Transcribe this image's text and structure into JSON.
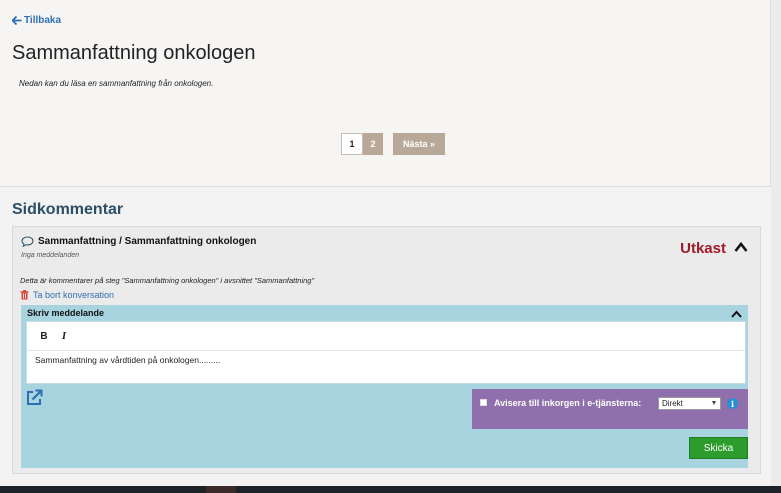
{
  "header": {
    "back_label": "Tillbaka",
    "title": "Sammanfattning onkologen",
    "intro": "Nedan kan du läsa en sammanfattning från onkologen."
  },
  "pager": {
    "current": "1",
    "page2": "2",
    "next_label": "Nästa »"
  },
  "comments": {
    "section_title": "Sidkommentar",
    "conversation": {
      "title": "Sammanfattning / Sammanfattning onkologen",
      "subtitle": "Inga meddelanden",
      "status": "Utkast",
      "description": "Detta är kommentarer på steg \"Sammanfattning onkologen\" i avsnittet \"Sammanfattning\"",
      "delete_label": "Ta bort konversation"
    },
    "composer": {
      "heading": "Skriv meddelande",
      "bold_label": "B",
      "italic_label": "I",
      "message_text": "Sammanfattning av vårdtiden på onkologen.........",
      "notify_label": "Avisera till inkorgen i e-tjänsterna:",
      "notify_option": "Direkt",
      "info_label": "i",
      "send_label": "Skicka"
    }
  },
  "colors": {
    "accent_link": "#2e6fb3",
    "status_draft": "#a01a2a",
    "composer_bg": "#a8d4df",
    "notify_bg": "#9070ac",
    "send_bg": "#2c9c2c"
  },
  "icons": {
    "back": "arrow-left-icon",
    "conversation": "speech-bubble-icon",
    "collapse": "chevron-up-icon",
    "delete": "trash-icon",
    "popout": "external-link-icon",
    "info": "info-icon"
  }
}
